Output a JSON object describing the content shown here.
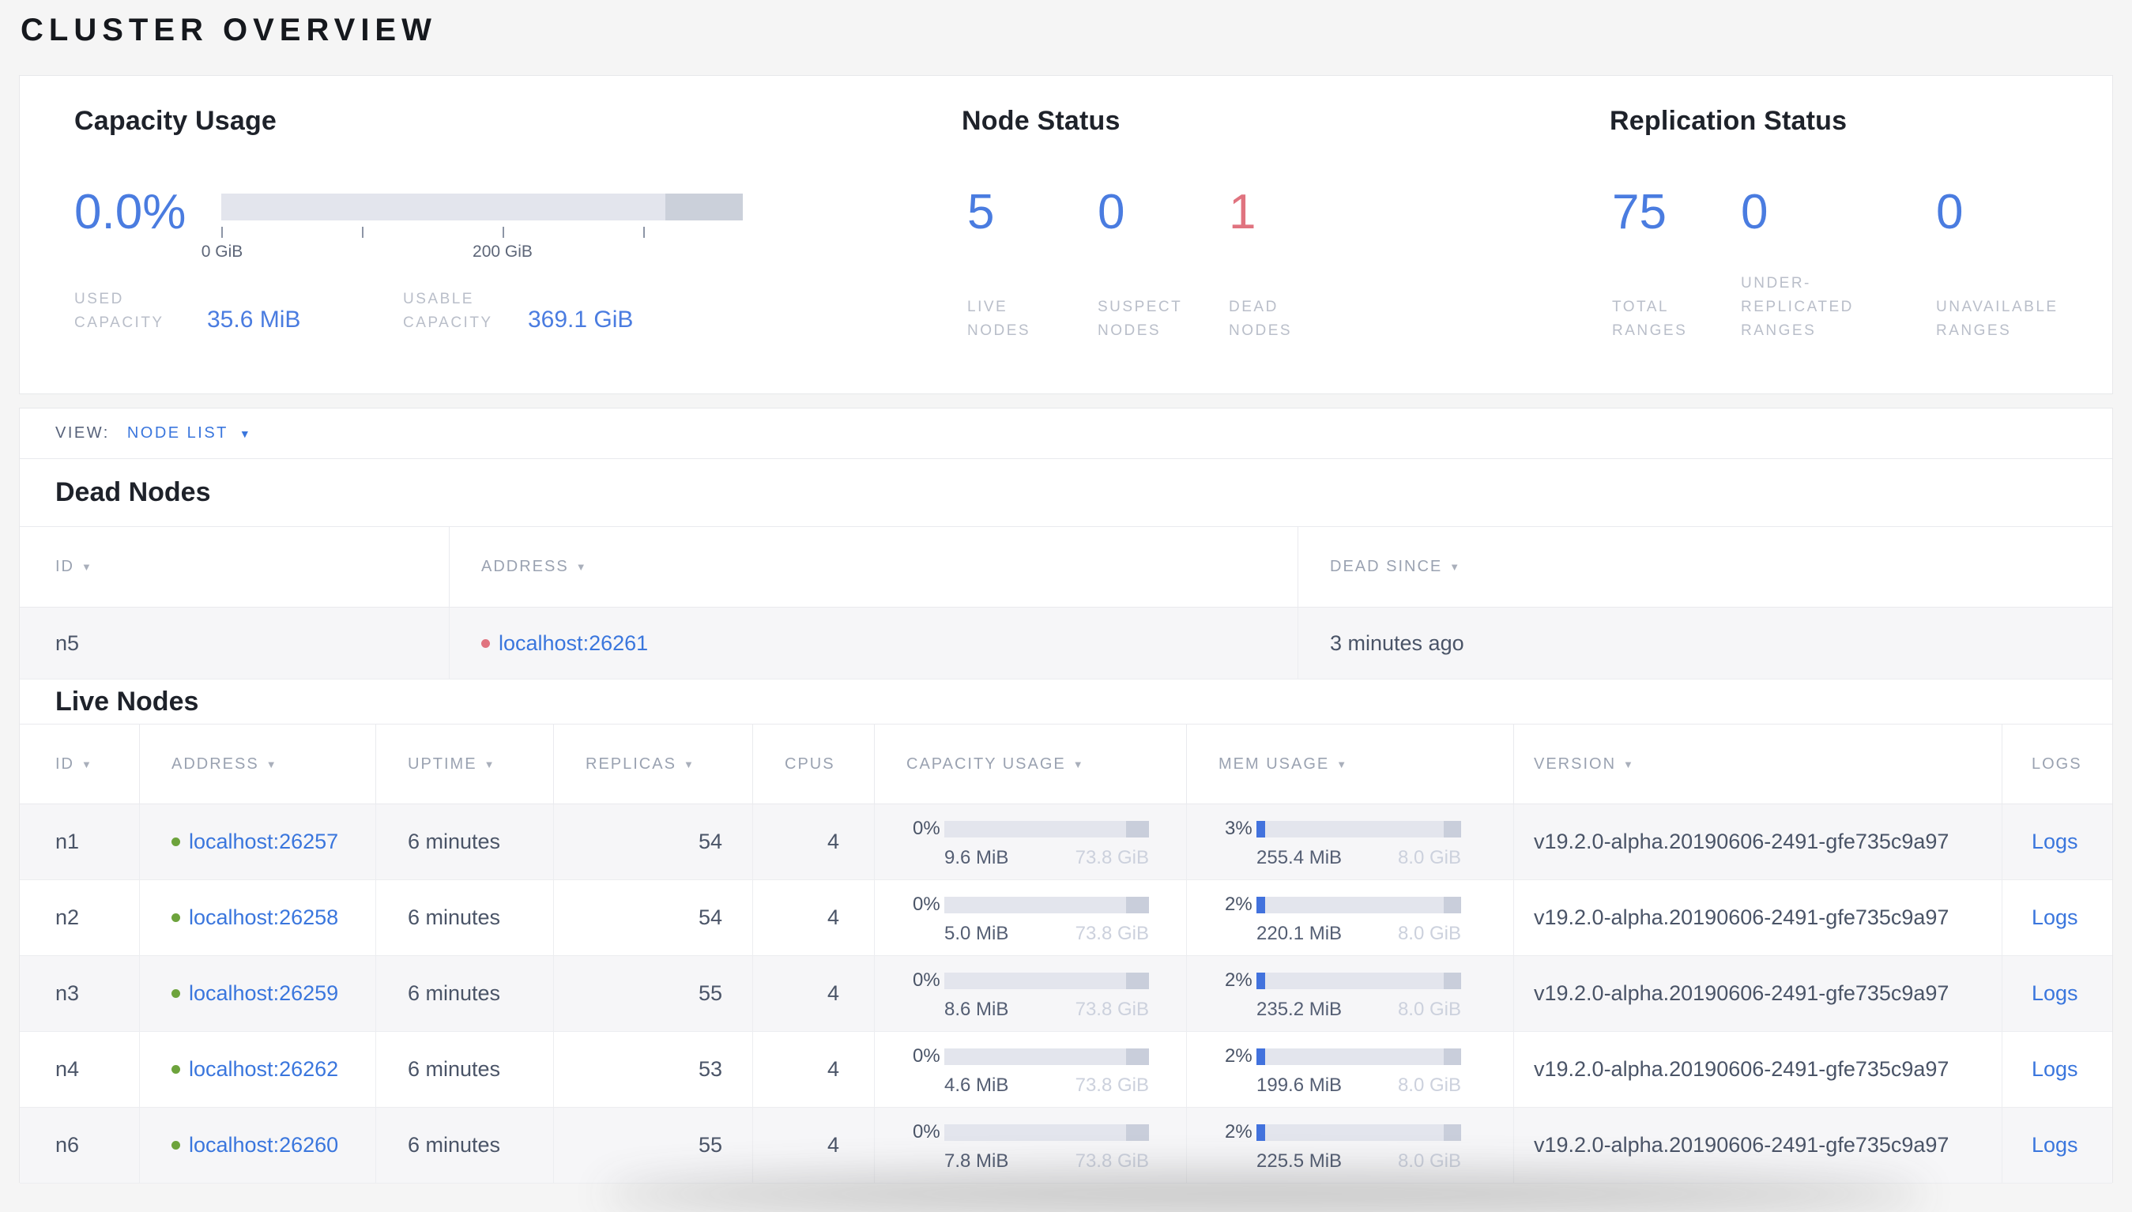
{
  "page": {
    "title": "CLUSTER OVERVIEW"
  },
  "colors": {
    "accent_blue": "#4a7ce0",
    "link_blue": "#3a76dd",
    "danger_red": "#e0737f",
    "live_green": "#6da33c",
    "bar_bg": "#e3e5ed",
    "bar_reserved": "#c9cedb"
  },
  "icons": {
    "sort_arrow": "▼",
    "dropdown_arrow": "▼"
  },
  "overview": {
    "capacity": {
      "heading": "Capacity Usage",
      "percent": "0.0%",
      "tick_label_0": "0 GiB",
      "tick_label_200": "200 GiB",
      "used_label": "USED\nCAPACITY",
      "used_value": "35.6 MiB",
      "usable_label": "USABLE\nCAPACITY",
      "usable_value": "369.1 GiB"
    },
    "node_status": {
      "heading": "Node Status",
      "stats": [
        {
          "value": "5",
          "label": "LIVE\nNODES"
        },
        {
          "value": "0",
          "label": "SUSPECT\nNODES"
        },
        {
          "value": "1",
          "label": "DEAD\nNODES"
        }
      ]
    },
    "replication": {
      "heading": "Replication Status",
      "stats": [
        {
          "value": "75",
          "label": "TOTAL\nRANGES"
        },
        {
          "value": "0",
          "label": "UNDER-\nREPLICATED\nRANGES"
        },
        {
          "value": "0",
          "label": "UNAVAILABLE\nRANGES"
        }
      ]
    }
  },
  "view_bar": {
    "label": "VIEW:",
    "selected": "NODE LIST"
  },
  "dead_nodes": {
    "heading": "Dead Nodes",
    "columns": [
      {
        "label": "ID"
      },
      {
        "label": "ADDRESS"
      },
      {
        "label": "DEAD SINCE"
      }
    ],
    "rows": [
      {
        "id": "n5",
        "address": "localhost:26261",
        "dead_since": "3 minutes ago"
      }
    ]
  },
  "live_nodes": {
    "heading": "Live Nodes",
    "columns": [
      {
        "label": "ID"
      },
      {
        "label": "ADDRESS"
      },
      {
        "label": "UPTIME"
      },
      {
        "label": "REPLICAS"
      },
      {
        "label": "CPUS"
      },
      {
        "label": "CAPACITY USAGE"
      },
      {
        "label": "MEM USAGE"
      },
      {
        "label": "VERSION"
      },
      {
        "label": "LOGS"
      }
    ],
    "logs_label": "Logs",
    "rows": [
      {
        "id": "n1",
        "address": "localhost:26257",
        "uptime": "6 minutes",
        "replicas": "54",
        "cpus": "4",
        "capacity": {
          "pct": "0%",
          "used": "9.6 MiB",
          "total": "73.8 GiB"
        },
        "memory": {
          "pct": "3%",
          "used": "255.4 MiB",
          "total": "8.0 GiB"
        },
        "version": "v19.2.0-alpha.20190606-2491-gfe735c9a97"
      },
      {
        "id": "n2",
        "address": "localhost:26258",
        "uptime": "6 minutes",
        "replicas": "54",
        "cpus": "4",
        "capacity": {
          "pct": "0%",
          "used": "5.0 MiB",
          "total": "73.8 GiB"
        },
        "memory": {
          "pct": "2%",
          "used": "220.1 MiB",
          "total": "8.0 GiB"
        },
        "version": "v19.2.0-alpha.20190606-2491-gfe735c9a97"
      },
      {
        "id": "n3",
        "address": "localhost:26259",
        "uptime": "6 minutes",
        "replicas": "55",
        "cpus": "4",
        "capacity": {
          "pct": "0%",
          "used": "8.6 MiB",
          "total": "73.8 GiB"
        },
        "memory": {
          "pct": "2%",
          "used": "235.2 MiB",
          "total": "8.0 GiB"
        },
        "version": "v19.2.0-alpha.20190606-2491-gfe735c9a97"
      },
      {
        "id": "n4",
        "address": "localhost:26262",
        "uptime": "6 minutes",
        "replicas": "53",
        "cpus": "4",
        "capacity": {
          "pct": "0%",
          "used": "4.6 MiB",
          "total": "73.8 GiB"
        },
        "memory": {
          "pct": "2%",
          "used": "199.6 MiB",
          "total": "8.0 GiB"
        },
        "version": "v19.2.0-alpha.20190606-2491-gfe735c9a97"
      },
      {
        "id": "n6",
        "address": "localhost:26260",
        "uptime": "6 minutes",
        "replicas": "55",
        "cpus": "4",
        "capacity": {
          "pct": "0%",
          "used": "7.8 MiB",
          "total": "73.8 GiB"
        },
        "memory": {
          "pct": "2%",
          "used": "225.5 MiB",
          "total": "8.0 GiB"
        },
        "version": "v19.2.0-alpha.20190606-2491-gfe735c9a97"
      }
    ]
  }
}
